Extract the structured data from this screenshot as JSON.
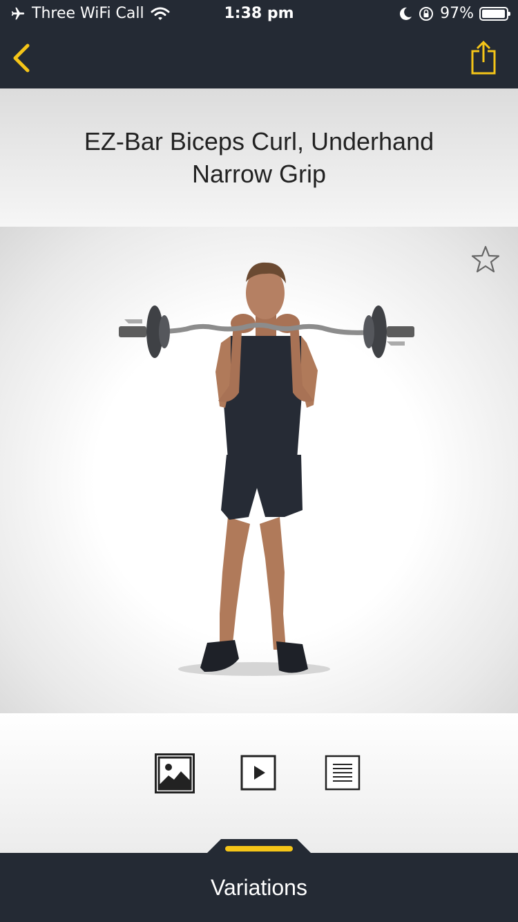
{
  "status_bar": {
    "carrier": "Three WiFi Call",
    "time": "1:38 pm",
    "battery_percent": "97%",
    "battery_level": 0.97
  },
  "nav": {
    "back_icon": "chevron-left-icon",
    "share_icon": "share-icon",
    "accent_color": "#f5c518"
  },
  "exercise": {
    "title": "EZ-Bar Biceps Curl, Underhand Narrow Grip"
  },
  "media_tabs": [
    {
      "icon": "image-icon",
      "selected": true
    },
    {
      "icon": "video-play-icon",
      "selected": false
    },
    {
      "icon": "instructions-icon",
      "selected": false
    }
  ],
  "bottom_bar": {
    "label": "Variations"
  },
  "colors": {
    "bar_bg": "#242a34",
    "accent": "#f5c518"
  }
}
